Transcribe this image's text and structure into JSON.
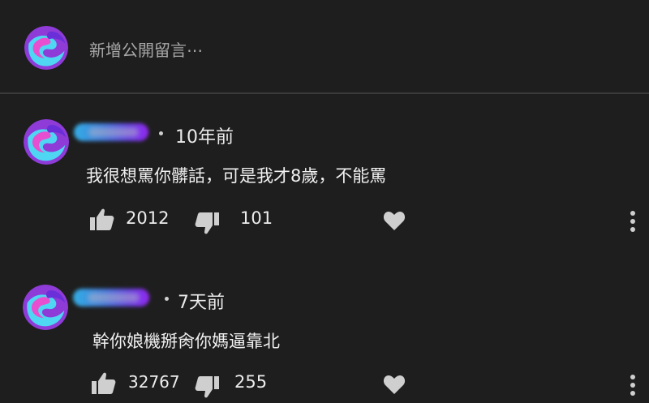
{
  "composer": {
    "placeholder": "新增公開留言⋯"
  },
  "comments": [
    {
      "time": "10年前",
      "text": "我很想罵你髒話，可是我才8歲，不能罵",
      "likes": "2012",
      "dislikes": "101"
    },
    {
      "time": "7天前",
      "text": "幹你娘機掰肏你媽逼靠北",
      "likes": "32767",
      "dislikes": "255"
    }
  ],
  "icons": {
    "avatar": "swirl-avatar-icon",
    "like": "thumbs-up-icon",
    "dislike": "thumbs-down-icon",
    "heart": "heart-icon",
    "more": "more-vertical-icon"
  },
  "colors": {
    "background": "#1e1e1e",
    "divider": "#3a3a3a",
    "placeholder_text": "#a8a8a8",
    "text": "#f0f0f0",
    "avatar_purple": "#8e3bd8",
    "avatar_cyan": "#4fd6f2"
  }
}
